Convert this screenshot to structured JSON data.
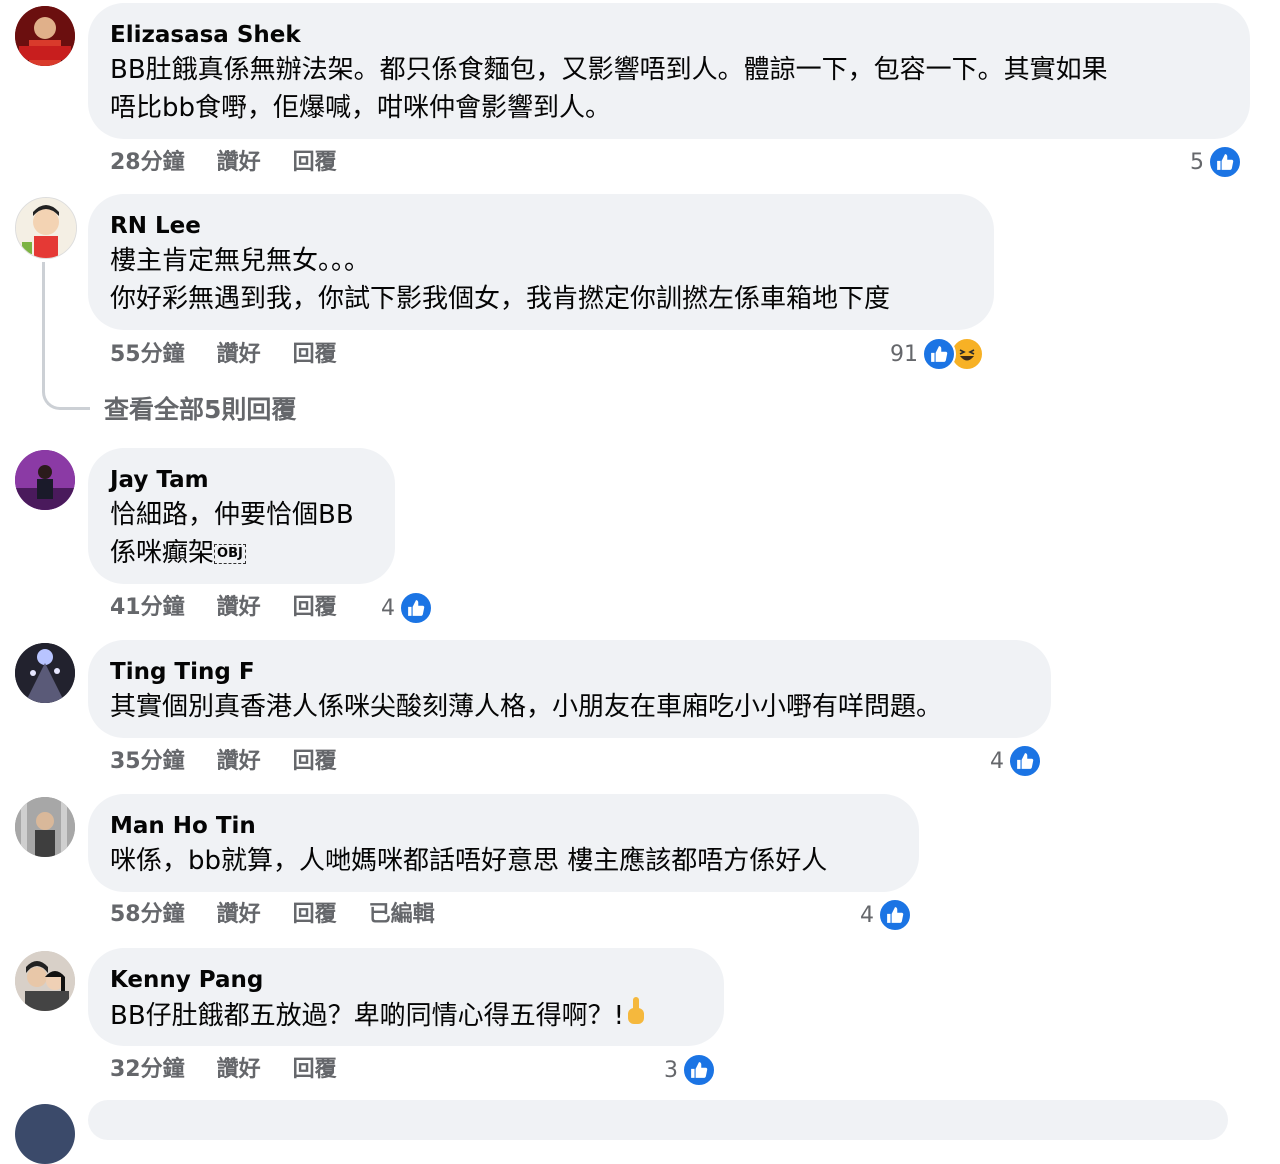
{
  "labels": {
    "like": "讚好",
    "reply": "回覆",
    "edited": "已編輯"
  },
  "view_all_replies": "查看全部5則回覆",
  "comments": [
    {
      "author": "Elizasasa Shek",
      "lines": [
        "BB肚餓真係無辦法架。都只係食麵包，又影響唔到人。體諒一下，包容一下。其實如果",
        "唔比bb食嘢，佢爆喊，咁咪仲會影響到人。"
      ],
      "time": "28分鐘",
      "reactions": "5"
    },
    {
      "author": "RN Lee",
      "lines": [
        "樓主肯定無兒無女。。。",
        "你好彩無遇到我，你試下影我個女，我肯撚定你訓撚左係車箱地下度"
      ],
      "time": "55分鐘",
      "reactions": "91"
    },
    {
      "author": "Jay Tam",
      "lines": [
        "恰細路，仲要恰個BB",
        "係咪癲架"
      ],
      "obj": "OBJ",
      "time": "41分鐘",
      "reactions": "4"
    },
    {
      "author": "Ting Ting F",
      "lines": [
        "其實個別真香港人係咪尖酸刻薄人格，小朋友在車廂吃小小嘢有咩問題。"
      ],
      "time": "35分鐘",
      "reactions": "4"
    },
    {
      "author": "Man Ho Tin",
      "lines": [
        "咪係，bb就算，人哋媽咪都話唔好意思 樓主應該都唔方係好人"
      ],
      "time": "58分鐘",
      "reactions": "4"
    },
    {
      "author": "Kenny Pang",
      "lines": [
        "BB仔肚餓都五放過？卑啲同情心得五得啊？!"
      ],
      "time": "32分鐘",
      "reactions": "3"
    }
  ],
  "colors": {
    "bubble": "#f0f2f5",
    "like": "#1b74e4",
    "meta": "#65676b"
  }
}
